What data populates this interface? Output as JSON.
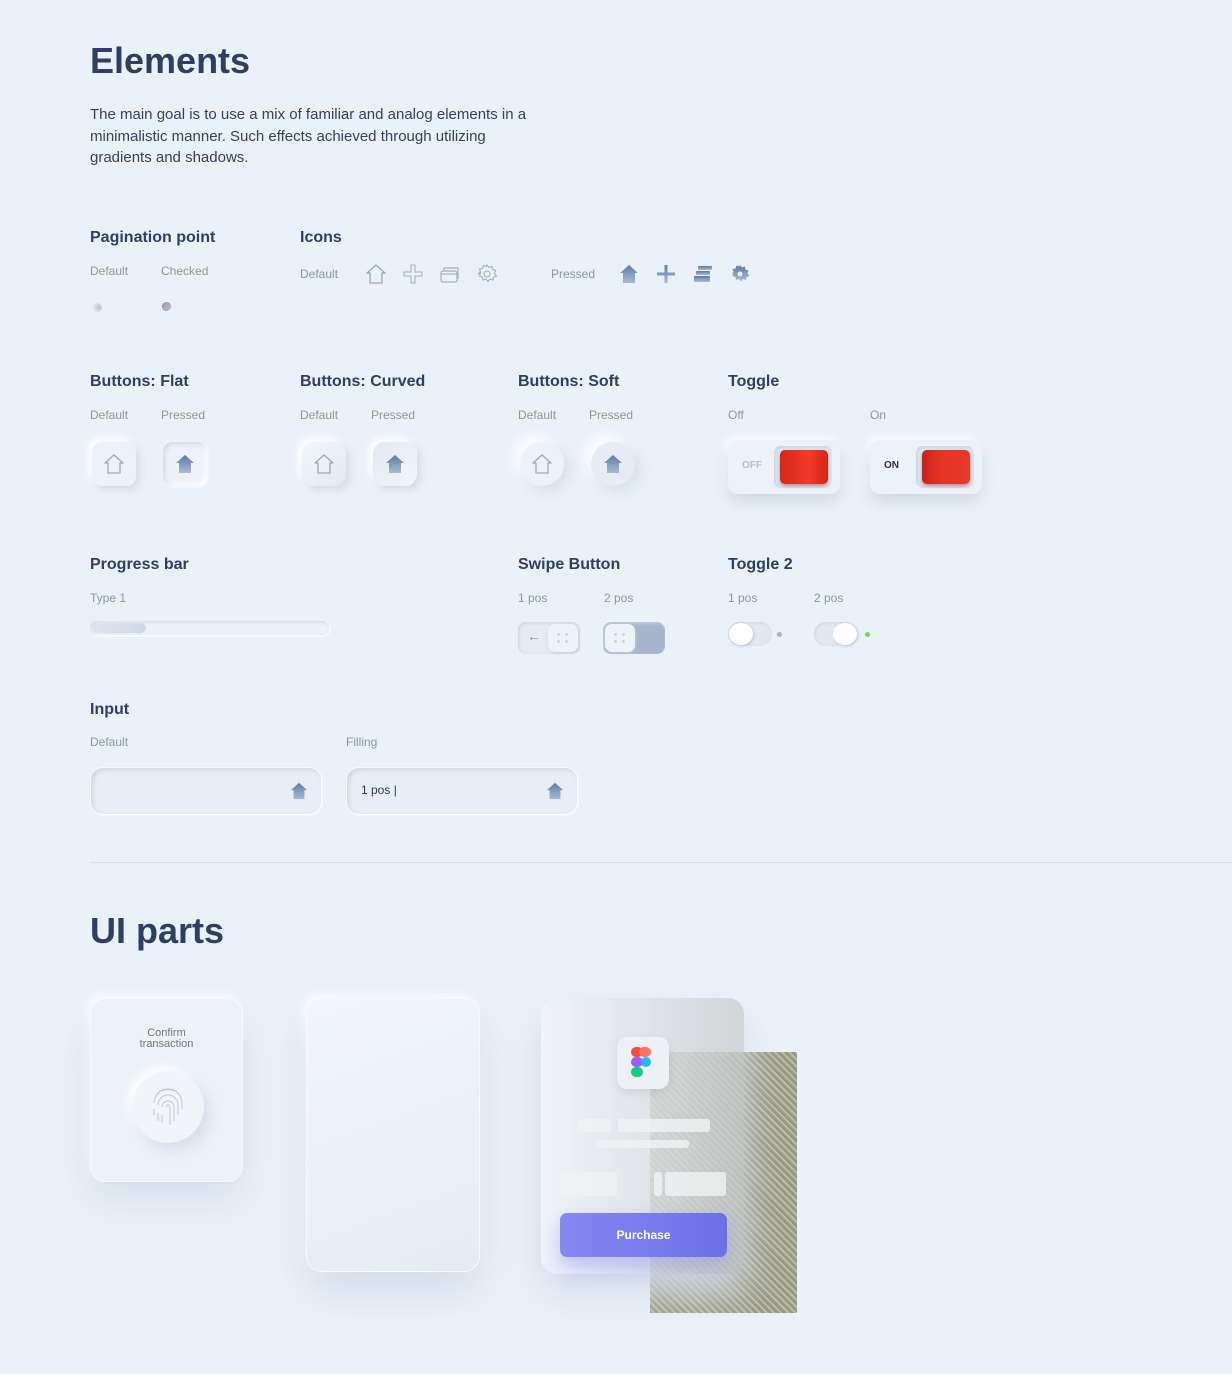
{
  "elements": {
    "title": "Elements",
    "description": "The main goal is to use a mix of familiar and analog elements in a minimalistic manner. Such effects achieved through utilizing gradients and shadows."
  },
  "pagination": {
    "title": "Pagination point",
    "default": "Default",
    "checked": "Checked"
  },
  "icons": {
    "title": "Icons",
    "default": "Default",
    "pressed": "Pressed",
    "items": [
      "home-icon",
      "plus-icon",
      "cards-icon",
      "gear-icon"
    ]
  },
  "buttons_flat": {
    "title": "Buttons: Flat",
    "default": "Default",
    "pressed": "Pressed"
  },
  "buttons_curved": {
    "title": "Buttons: Curved",
    "default": "Default",
    "pressed": "Pressed"
  },
  "buttons_soft": {
    "title": "Buttons: Soft",
    "default": "Default",
    "pressed": "Pressed"
  },
  "toggle": {
    "title": "Toggle",
    "off_label": "Off",
    "on_label": "On",
    "off_text": "OFF",
    "on_text": "ON"
  },
  "progress": {
    "title": "Progress bar",
    "type": "Type 1",
    "value": 0.23
  },
  "swipe": {
    "title": "Swipe Button",
    "pos1": "1 pos",
    "pos2": "2 pos"
  },
  "toggle2": {
    "title": "Toggle 2",
    "pos1": "1 pos",
    "pos2": "2 pos",
    "active_color": "#6fdc4f"
  },
  "input": {
    "title": "Input",
    "default": "Default",
    "filling": "Filling",
    "filling_value": "1 pos |"
  },
  "ui_parts": {
    "title": "UI parts",
    "confirm": "Confirm transaction",
    "purchase": "Purchase",
    "purchase_color": "#7479ee"
  }
}
